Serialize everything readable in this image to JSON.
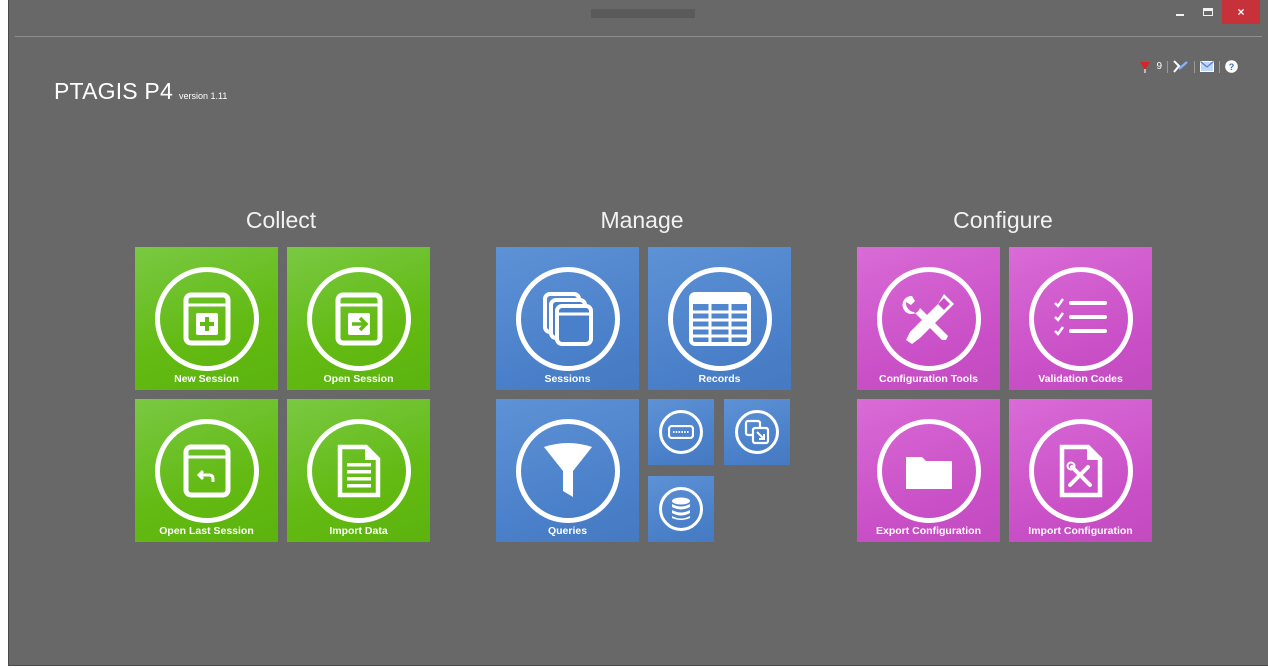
{
  "window": {
    "minimize_icon": "minimize-icon",
    "maximize_icon": "maximize-icon",
    "close_label": "×",
    "close_color": "#c7313a",
    "background": "#686868"
  },
  "header": {
    "app_name": "PTAGIS P4",
    "version": "version 1.11"
  },
  "toolbar": {
    "alert_count": "9",
    "icons": [
      "tag-flag-icon",
      "feedback-icon",
      "mail-icon",
      "help-icon"
    ]
  },
  "groups": {
    "collect": {
      "heading": "Collect",
      "color": "#62ba12",
      "tiles": [
        {
          "label": "New Session",
          "icon": "new-session-icon"
        },
        {
          "label": "Open Session",
          "icon": "open-session-icon"
        },
        {
          "label": "Open Last Session",
          "icon": "open-last-session-icon"
        },
        {
          "label": "Import Data",
          "icon": "import-data-icon"
        }
      ]
    },
    "manage": {
      "heading": "Manage",
      "color": "#4a80c9",
      "tiles": [
        {
          "label": "Sessions",
          "icon": "sessions-icon"
        },
        {
          "label": "Records",
          "icon": "records-icon"
        },
        {
          "label": "Queries",
          "icon": "filter-icon"
        }
      ],
      "small_tiles": [
        {
          "icon": "tag-reader-icon"
        },
        {
          "icon": "export-window-icon"
        },
        {
          "icon": "database-icon"
        }
      ]
    },
    "configure": {
      "heading": "Configure",
      "color": "#c94fc6",
      "tiles": [
        {
          "label": "Configuration Tools",
          "icon": "tools-icon"
        },
        {
          "label": "Validation Codes",
          "icon": "checklist-icon"
        },
        {
          "label": "Export Configuration",
          "icon": "folder-icon"
        },
        {
          "label": "Import Configuration",
          "icon": "import-config-icon"
        }
      ]
    }
  }
}
